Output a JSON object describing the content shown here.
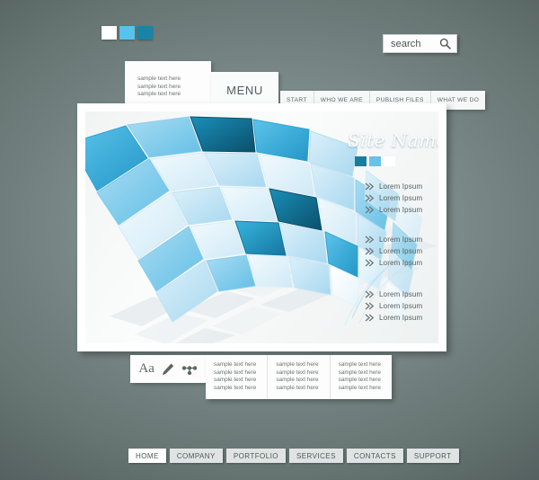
{
  "background": {
    "color_center": "#8a9a98",
    "color_edge": "#4f5c5b"
  },
  "top_swatches": [
    {
      "name": "swatch-white",
      "color": "#ffffff"
    },
    {
      "name": "swatch-light-blue",
      "color": "#55c3ec"
    },
    {
      "name": "swatch-teal",
      "color": "#1a84a8"
    }
  ],
  "search": {
    "value": "search",
    "placeholder": "search",
    "icon": "magnifier-icon"
  },
  "top_card": {
    "lines": [
      "sample text here",
      "sample text here",
      "sample text here"
    ]
  },
  "menu": {
    "label": "MENU"
  },
  "nav": {
    "items": [
      {
        "label": "START"
      },
      {
        "label": "WHO WE ARE"
      },
      {
        "label": "PUBLISH FILES"
      },
      {
        "label": "WHAT WE DO"
      }
    ]
  },
  "site_name": {
    "text": "Site Name",
    "swatches": [
      {
        "name": "site-swatch-teal",
        "color": "#1a7d9e"
      },
      {
        "name": "site-swatch-blue",
        "color": "#6ac1e6"
      },
      {
        "name": "site-swatch-white",
        "color": "#ffffff"
      }
    ]
  },
  "lorem_groups": [
    {
      "items": [
        "Lorem Ipsum",
        "Lorem Ipsum",
        "Lorem Ipsum"
      ]
    },
    {
      "items": [
        "Lorem Ipsum",
        "Lorem Ipsum",
        "Lorem Ipsum"
      ]
    },
    {
      "items": [
        "Lorem Ipsum",
        "Lorem Ipsum",
        "Lorem Ipsum"
      ]
    }
  ],
  "icon_panel": {
    "icons": [
      {
        "name": "text-style-icon",
        "label": "Aa"
      },
      {
        "name": "pencil-icon",
        "label": ""
      },
      {
        "name": "network-nodes-icon",
        "label": ""
      }
    ]
  },
  "bottom_columns": [
    {
      "lines": [
        "sample text here",
        "sample text here",
        "sample text here",
        "sample text here"
      ]
    },
    {
      "lines": [
        "sample text here",
        "sample text here",
        "sample text here",
        "sample text here"
      ]
    },
    {
      "lines": [
        "sample text here",
        "sample text here",
        "sample text here",
        "sample text here"
      ]
    }
  ],
  "footer": {
    "items": [
      {
        "label": "HOME",
        "active": true
      },
      {
        "label": "COMPANY",
        "active": false
      },
      {
        "label": "PORTFOLIO",
        "active": false
      },
      {
        "label": "SERVICES",
        "active": false
      },
      {
        "label": "CONTACTS",
        "active": false
      },
      {
        "label": "SUPPORT",
        "active": false
      }
    ]
  },
  "graphic": {
    "name": "abstract-blue-mosaic-tiles",
    "palette": {
      "dark_teal": "#0d5c7a",
      "mid_teal": "#1a84a8",
      "bright_blue": "#29a8d8",
      "light_blue": "#79c9ea",
      "pale_blue": "#b8dff2",
      "very_pale": "#dff0f9",
      "grid_gray": "#dfe5e8"
    }
  }
}
